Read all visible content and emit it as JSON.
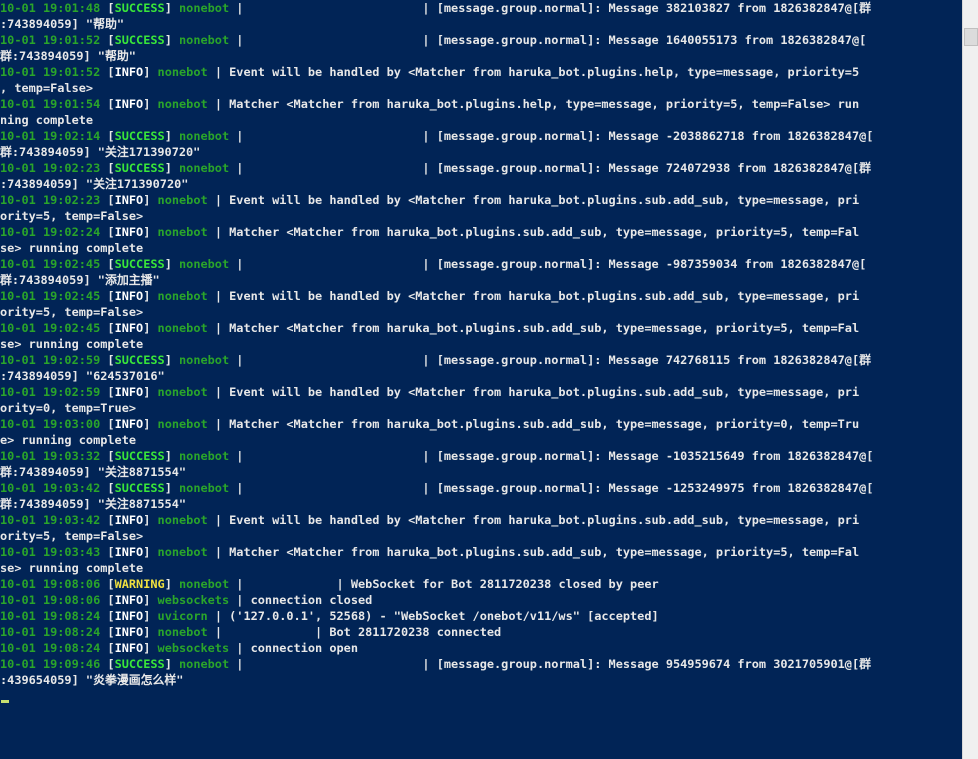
{
  "terminal": {
    "lines": [
      {
        "ts": "10-01 19:01:48",
        "level": "SUCCESS",
        "module": "nonebot",
        "text": " |                         | [message.group.normal]: Message 382103827 from 1826382847@[群"
      },
      {
        "ts": "",
        "level": "",
        "module": "",
        "text": ":743894059] \"帮助\""
      },
      {
        "ts": "10-01 19:01:52",
        "level": "SUCCESS",
        "module": "nonebot",
        "text": " |                         | [message.group.normal]: Message 1640055173 from 1826382847@["
      },
      {
        "ts": "",
        "level": "",
        "module": "",
        "text": "群:743894059] \"帮助\""
      },
      {
        "ts": "10-01 19:01:52",
        "level": "INFO",
        "module": "nonebot",
        "text": " | Event will be handled by <Matcher from haruka_bot.plugins.help, type=message, priority=5"
      },
      {
        "ts": "",
        "level": "",
        "module": "",
        "text": ", temp=False>"
      },
      {
        "ts": "10-01 19:01:54",
        "level": "INFO",
        "module": "nonebot",
        "text": " | Matcher <Matcher from haruka_bot.plugins.help, type=message, priority=5, temp=False> run"
      },
      {
        "ts": "",
        "level": "",
        "module": "",
        "text": "ning complete"
      },
      {
        "ts": "10-01 19:02:14",
        "level": "SUCCESS",
        "module": "nonebot",
        "text": " |                         | [message.group.normal]: Message -2038862718 from 1826382847@["
      },
      {
        "ts": "",
        "level": "",
        "module": "",
        "text": "群:743894059] \"关注171390720\""
      },
      {
        "ts": "10-01 19:02:23",
        "level": "SUCCESS",
        "module": "nonebot",
        "text": " |                         | [message.group.normal]: Message 724072938 from 1826382847@[群"
      },
      {
        "ts": "",
        "level": "",
        "module": "",
        "text": ":743894059] \"关注171390720\""
      },
      {
        "ts": "10-01 19:02:23",
        "level": "INFO",
        "module": "nonebot",
        "text": " | Event will be handled by <Matcher from haruka_bot.plugins.sub.add_sub, type=message, pri"
      },
      {
        "ts": "",
        "level": "",
        "module": "",
        "text": "ority=5, temp=False>"
      },
      {
        "ts": "10-01 19:02:24",
        "level": "INFO",
        "module": "nonebot",
        "text": " | Matcher <Matcher from haruka_bot.plugins.sub.add_sub, type=message, priority=5, temp=Fal"
      },
      {
        "ts": "",
        "level": "",
        "module": "",
        "text": "se> running complete"
      },
      {
        "ts": "10-01 19:02:45",
        "level": "SUCCESS",
        "module": "nonebot",
        "text": " |                         | [message.group.normal]: Message -987359034 from 1826382847@["
      },
      {
        "ts": "",
        "level": "",
        "module": "",
        "text": "群:743894059] \"添加主播\""
      },
      {
        "ts": "10-01 19:02:45",
        "level": "INFO",
        "module": "nonebot",
        "text": " | Event will be handled by <Matcher from haruka_bot.plugins.sub.add_sub, type=message, pri"
      },
      {
        "ts": "",
        "level": "",
        "module": "",
        "text": "ority=5, temp=False>"
      },
      {
        "ts": "10-01 19:02:45",
        "level": "INFO",
        "module": "nonebot",
        "text": " | Matcher <Matcher from haruka_bot.plugins.sub.add_sub, type=message, priority=5, temp=Fal"
      },
      {
        "ts": "",
        "level": "",
        "module": "",
        "text": "se> running complete"
      },
      {
        "ts": "10-01 19:02:59",
        "level": "SUCCESS",
        "module": "nonebot",
        "text": " |                         | [message.group.normal]: Message 742768115 from 1826382847@[群"
      },
      {
        "ts": "",
        "level": "",
        "module": "",
        "text": ":743894059] \"624537016\""
      },
      {
        "ts": "10-01 19:02:59",
        "level": "INFO",
        "module": "nonebot",
        "text": " | Event will be handled by <Matcher from haruka_bot.plugins.sub.add_sub, type=message, pri"
      },
      {
        "ts": "",
        "level": "",
        "module": "",
        "text": "ority=0, temp=True>"
      },
      {
        "ts": "10-01 19:03:00",
        "level": "INFO",
        "module": "nonebot",
        "text": " | Matcher <Matcher from haruka_bot.plugins.sub.add_sub, type=message, priority=0, temp=Tru"
      },
      {
        "ts": "",
        "level": "",
        "module": "",
        "text": "e> running complete"
      },
      {
        "ts": "10-01 19:03:32",
        "level": "SUCCESS",
        "module": "nonebot",
        "text": " |                         | [message.group.normal]: Message -1035215649 from 1826382847@["
      },
      {
        "ts": "",
        "level": "",
        "module": "",
        "text": "群:743894059] \"关注8871554\""
      },
      {
        "ts": "10-01 19:03:42",
        "level": "SUCCESS",
        "module": "nonebot",
        "text": " |                         | [message.group.normal]: Message -1253249975 from 1826382847@["
      },
      {
        "ts": "",
        "level": "",
        "module": "",
        "text": "群:743894059] \"关注8871554\""
      },
      {
        "ts": "10-01 19:03:42",
        "level": "INFO",
        "module": "nonebot",
        "text": " | Event will be handled by <Matcher from haruka_bot.plugins.sub.add_sub, type=message, pri"
      },
      {
        "ts": "",
        "level": "",
        "module": "",
        "text": "ority=5, temp=False>"
      },
      {
        "ts": "10-01 19:03:43",
        "level": "INFO",
        "module": "nonebot",
        "text": " | Matcher <Matcher from haruka_bot.plugins.sub.add_sub, type=message, priority=5, temp=Fal"
      },
      {
        "ts": "",
        "level": "",
        "module": "",
        "text": "se> running complete"
      },
      {
        "ts": "10-01 19:08:06",
        "level": "WARNING",
        "module": "nonebot",
        "text": " |             | WebSocket for Bot 2811720238 closed by peer"
      },
      {
        "ts": "10-01 19:08:06",
        "level": "INFO",
        "module": "websockets",
        "text": " | connection closed"
      },
      {
        "ts": "10-01 19:08:24",
        "level": "INFO",
        "module": "uvicorn",
        "text": " | ('127.0.0.1', 52568) - \"WebSocket /onebot/v11/ws\" [accepted]"
      },
      {
        "ts": "10-01 19:08:24",
        "level": "INFO",
        "module": "nonebot",
        "text": " |             | Bot 2811720238 connected"
      },
      {
        "ts": "10-01 19:08:24",
        "level": "INFO",
        "module": "websockets",
        "text": " | connection open"
      },
      {
        "ts": "10-01 19:09:46",
        "level": "SUCCESS",
        "module": "nonebot",
        "text": " |                         | [message.group.normal]: Message 954959674 from 3021705901@[群"
      },
      {
        "ts": "",
        "level": "",
        "module": "",
        "text": ":439654059] \"炎拳漫画怎么样\""
      }
    ]
  },
  "colors": {
    "background": "#012456",
    "timestamp": "#2aa52a",
    "success": "#39e639",
    "info": "#ffffff",
    "warning": "#f0e040",
    "text": "#e8e8e8"
  }
}
